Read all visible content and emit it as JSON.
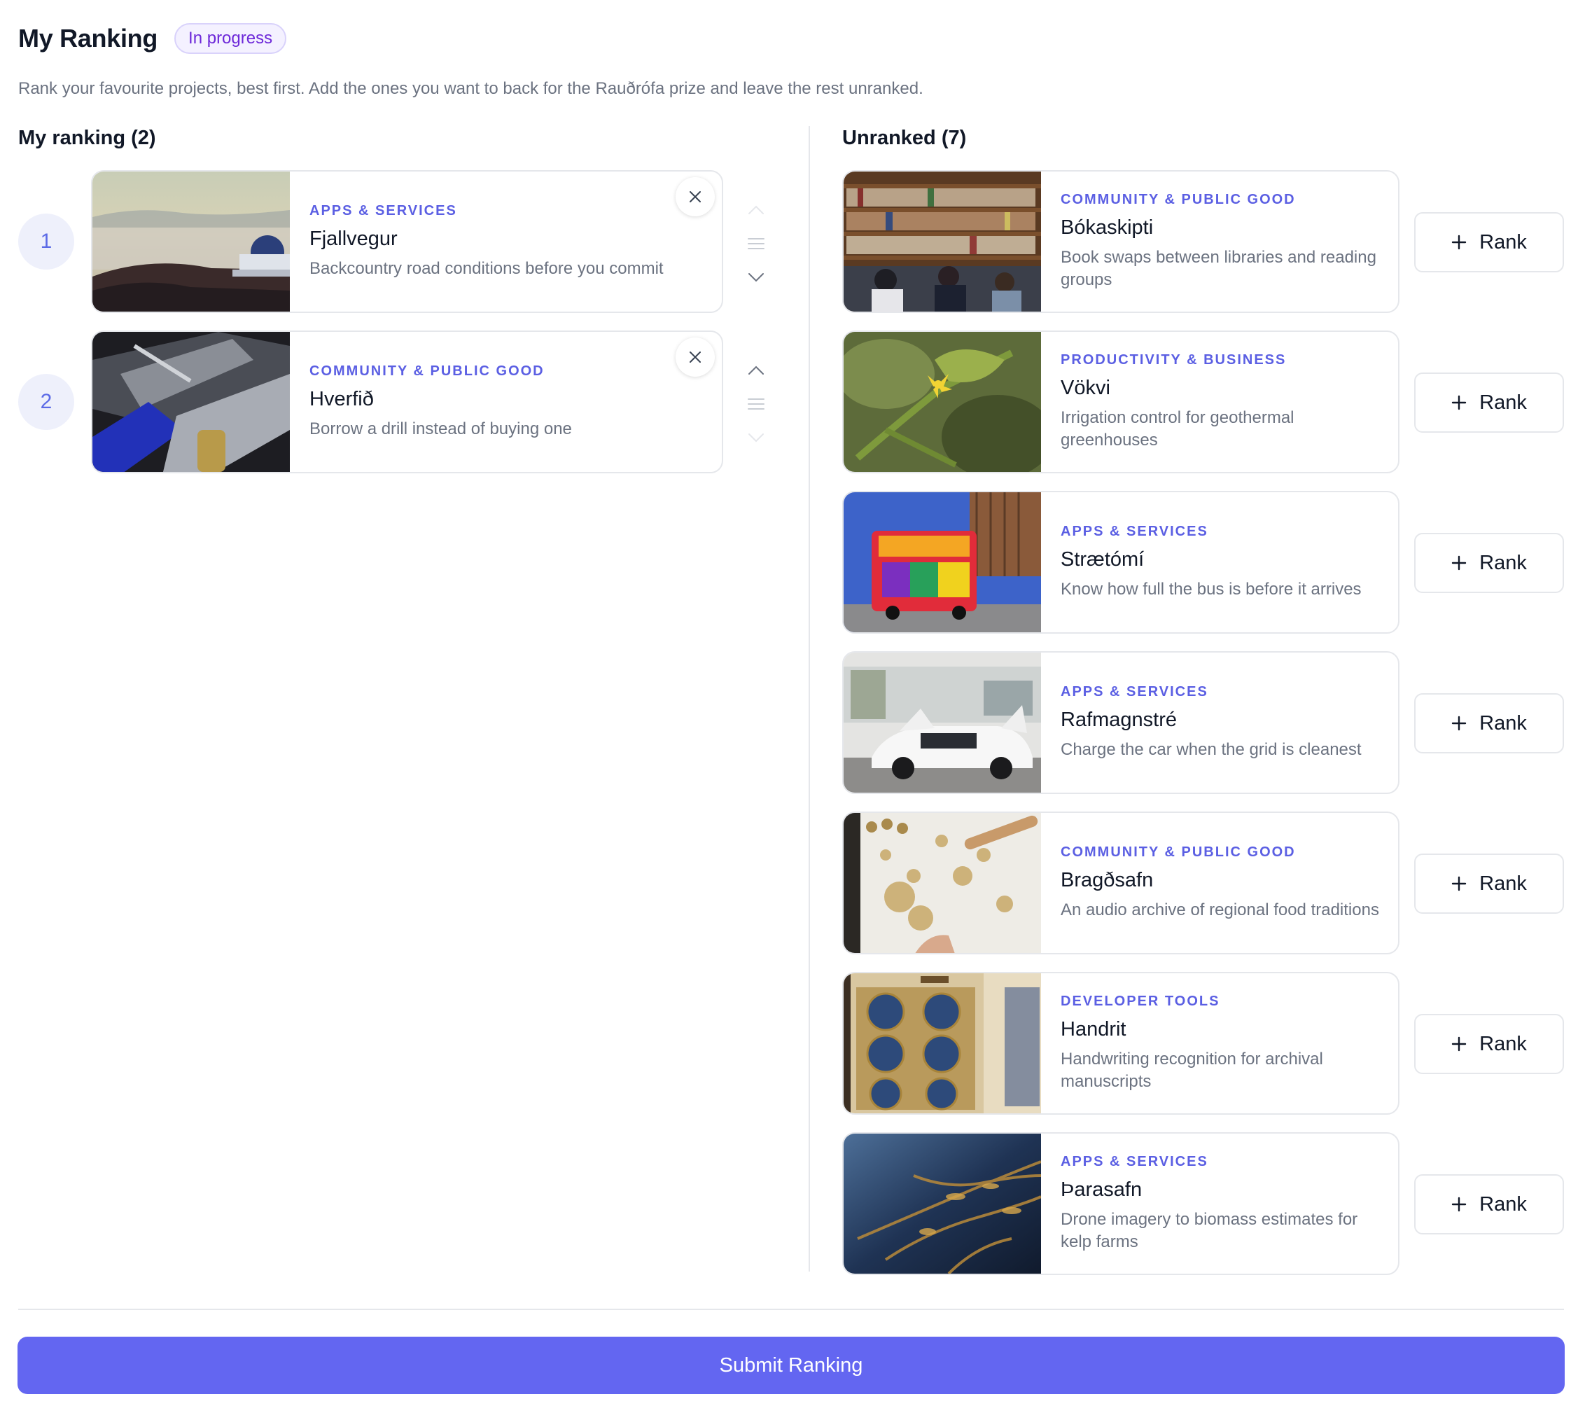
{
  "header": {
    "title": "My Ranking",
    "status_badge": "In progress",
    "subtitle": "Rank your favourite projects, best first. Add the ones you want to back for the Rauðrófa prize and leave the rest unranked."
  },
  "ranked": {
    "heading": "My ranking (2)",
    "items": [
      {
        "rank": "1",
        "category": "APPS & SERVICES",
        "name": "Fjallvegur",
        "description": "Backcountry road conditions before you commit",
        "image": "observatory-landscape"
      },
      {
        "rank": "2",
        "category": "COMMUNITY & PUBLIC GOOD",
        "name": "Hverfið",
        "description": "Borrow a drill instead of buying one",
        "image": "tools-closeup"
      }
    ]
  },
  "unranked": {
    "heading": "Unranked (7)",
    "rank_button_label": "Rank",
    "items": [
      {
        "category": "COMMUNITY & PUBLIC GOOD",
        "name": "Bókaskipti",
        "description": "Book swaps between libraries and reading groups",
        "image": "library-shelves"
      },
      {
        "category": "PRODUCTIVITY & BUSINESS",
        "name": "Vökvi",
        "description": "Irrigation control for geothermal greenhouses",
        "image": "tomato-flower"
      },
      {
        "category": "APPS & SERVICES",
        "name": "Strætómí",
        "description": "Know how full the bus is before it arrives",
        "image": "colorful-bus"
      },
      {
        "category": "APPS & SERVICES",
        "name": "Rafmagnstré",
        "description": "Charge the car when the grid is cleanest",
        "image": "white-electric-car"
      },
      {
        "category": "COMMUNITY & PUBLIC GOOD",
        "name": "Bragðsafn",
        "description": "An audio archive of regional food traditions",
        "image": "baking-dough"
      },
      {
        "category": "DEVELOPER TOOLS",
        "name": "Handrit",
        "description": "Handwriting recognition for archival manuscripts",
        "image": "illuminated-manuscript"
      },
      {
        "category": "APPS & SERVICES",
        "name": "Þarasafn",
        "description": "Drone imagery to biomass estimates for kelp farms",
        "image": "kelp-water"
      }
    ]
  },
  "footer": {
    "submit_label": "Submit Ranking"
  },
  "colors": {
    "accent": "#6366f1",
    "category_text": "#5b5fe3",
    "badge_text": "#6d28d9",
    "badge_bg": "#f4f1ff"
  }
}
